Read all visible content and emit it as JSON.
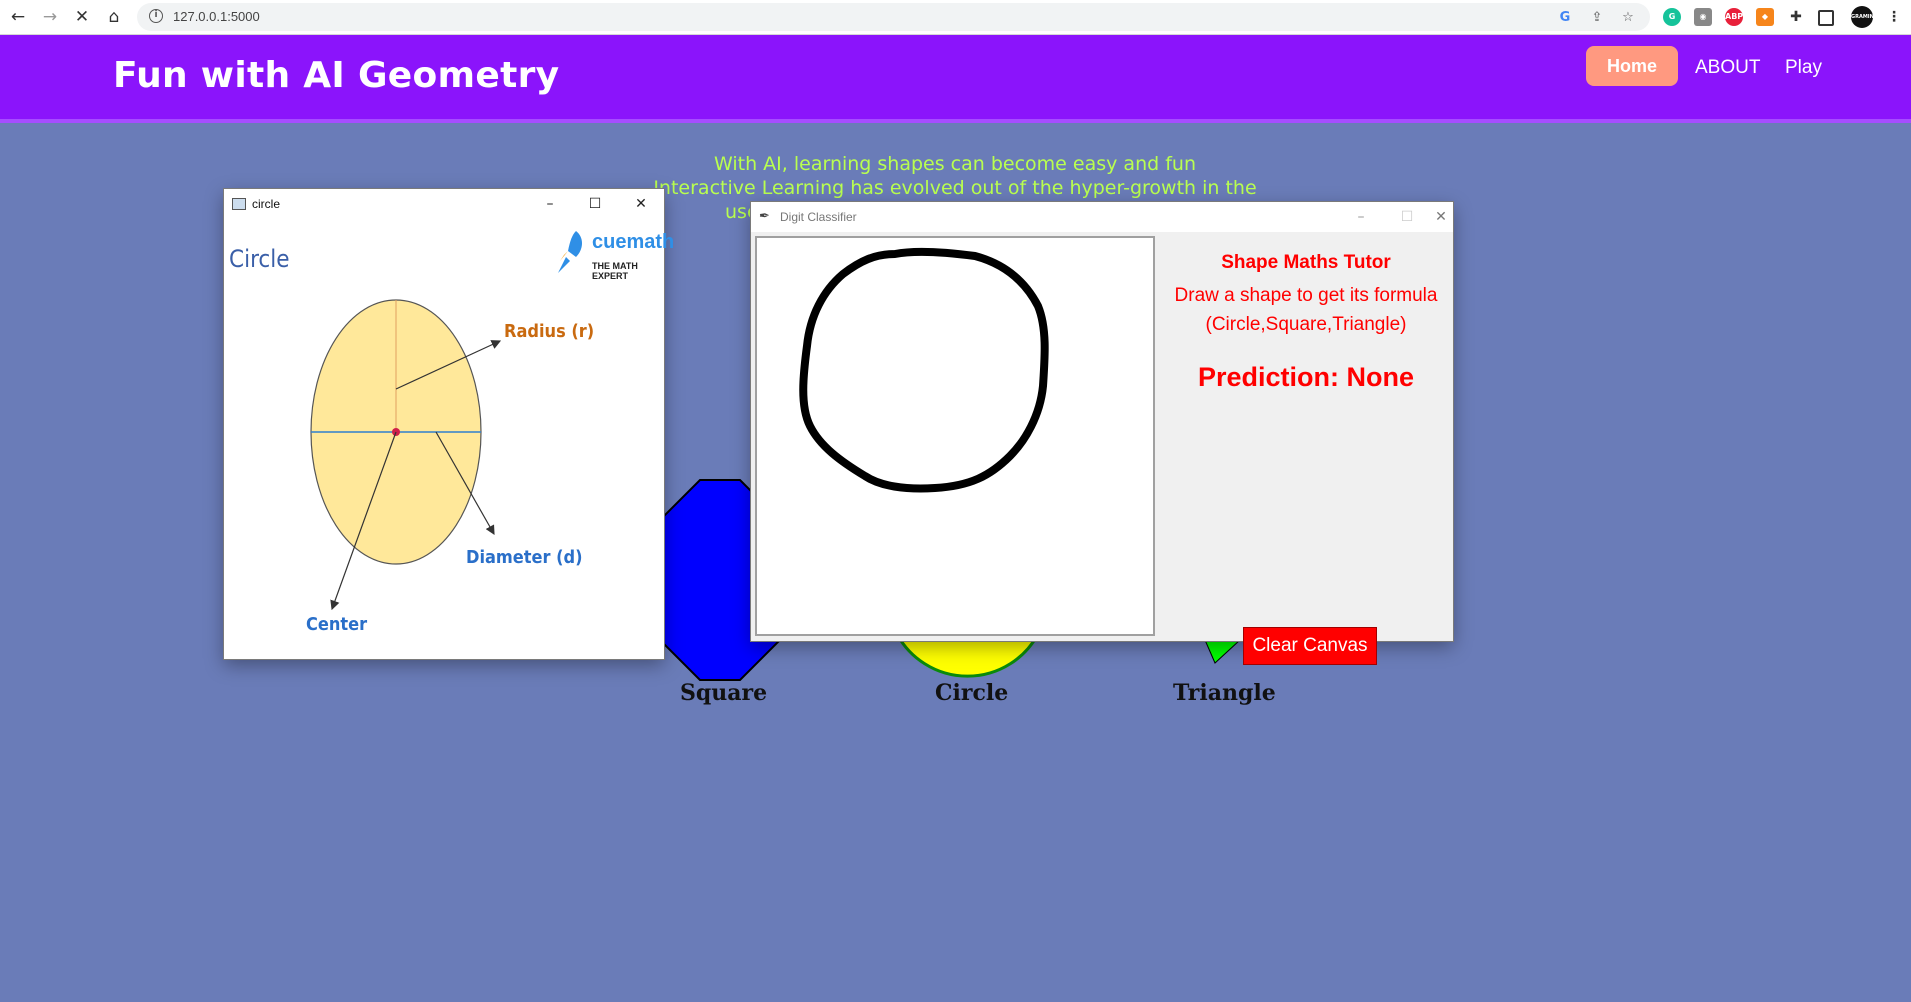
{
  "browser": {
    "url": "127.0.0.1:5000",
    "extensions": [
      "google-icon",
      "share-icon",
      "star-icon",
      "grammarly-icon",
      "camera-icon",
      "adblock-icon",
      "metamask-icon",
      "puzzle-icon",
      "sidepanel-icon",
      "profile-icon",
      "menu-icon"
    ],
    "adblock_label": "ABP",
    "profile_label": "GRAMING"
  },
  "site": {
    "brand": "Fun with AI Geometry",
    "nav": {
      "home": "Home",
      "about": "ABOUT",
      "play": "Play"
    },
    "intro_line1": "With AI, learning shapes can become easy and fun",
    "intro_line2": "Interactive Learning has evolved out of the hyper-growth in the",
    "intro_line3_partial": "use",
    "shapes": {
      "square": "Square",
      "circle": "Circle",
      "triangle": "Triangle"
    }
  },
  "circle_window": {
    "title": "circle",
    "heading": "Circle",
    "logo_main": "cuemath",
    "logo_tagline": "THE MATH EXPERT",
    "labels": {
      "radius": "Radius (r)",
      "diameter": "Diameter (d)",
      "center": "Center"
    }
  },
  "classifier_window": {
    "title": "Digit Classifier",
    "tutor_title": "Shape Maths Tutor",
    "instruction_line1": "Draw a shape to get its formula",
    "instruction_line2": "(Circle,Square,Triangle)",
    "prediction": "Prediction: None",
    "clear_button": "Clear Canvas"
  },
  "colors": {
    "page_bg": "#6a7cb8",
    "header_bg": "#8b14fb",
    "home_button": "#ff9980",
    "intro_text": "#b9ff4f",
    "tutor_red": "#ff0000",
    "square_fill": "#0000ff",
    "circle_fill": "#ffff00",
    "triangle_fill": "#00ff00"
  }
}
